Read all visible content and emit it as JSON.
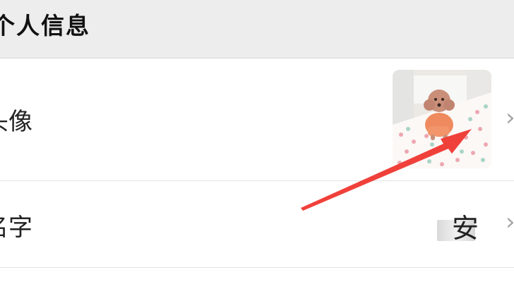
{
  "header": {
    "title": "个人信息"
  },
  "rows": {
    "avatar": {
      "label": "头像",
      "chevron": "›"
    },
    "name": {
      "label": "名字",
      "value": "安",
      "chevron": "›"
    }
  },
  "annotation": {
    "arrow_color": "#f0403a"
  }
}
